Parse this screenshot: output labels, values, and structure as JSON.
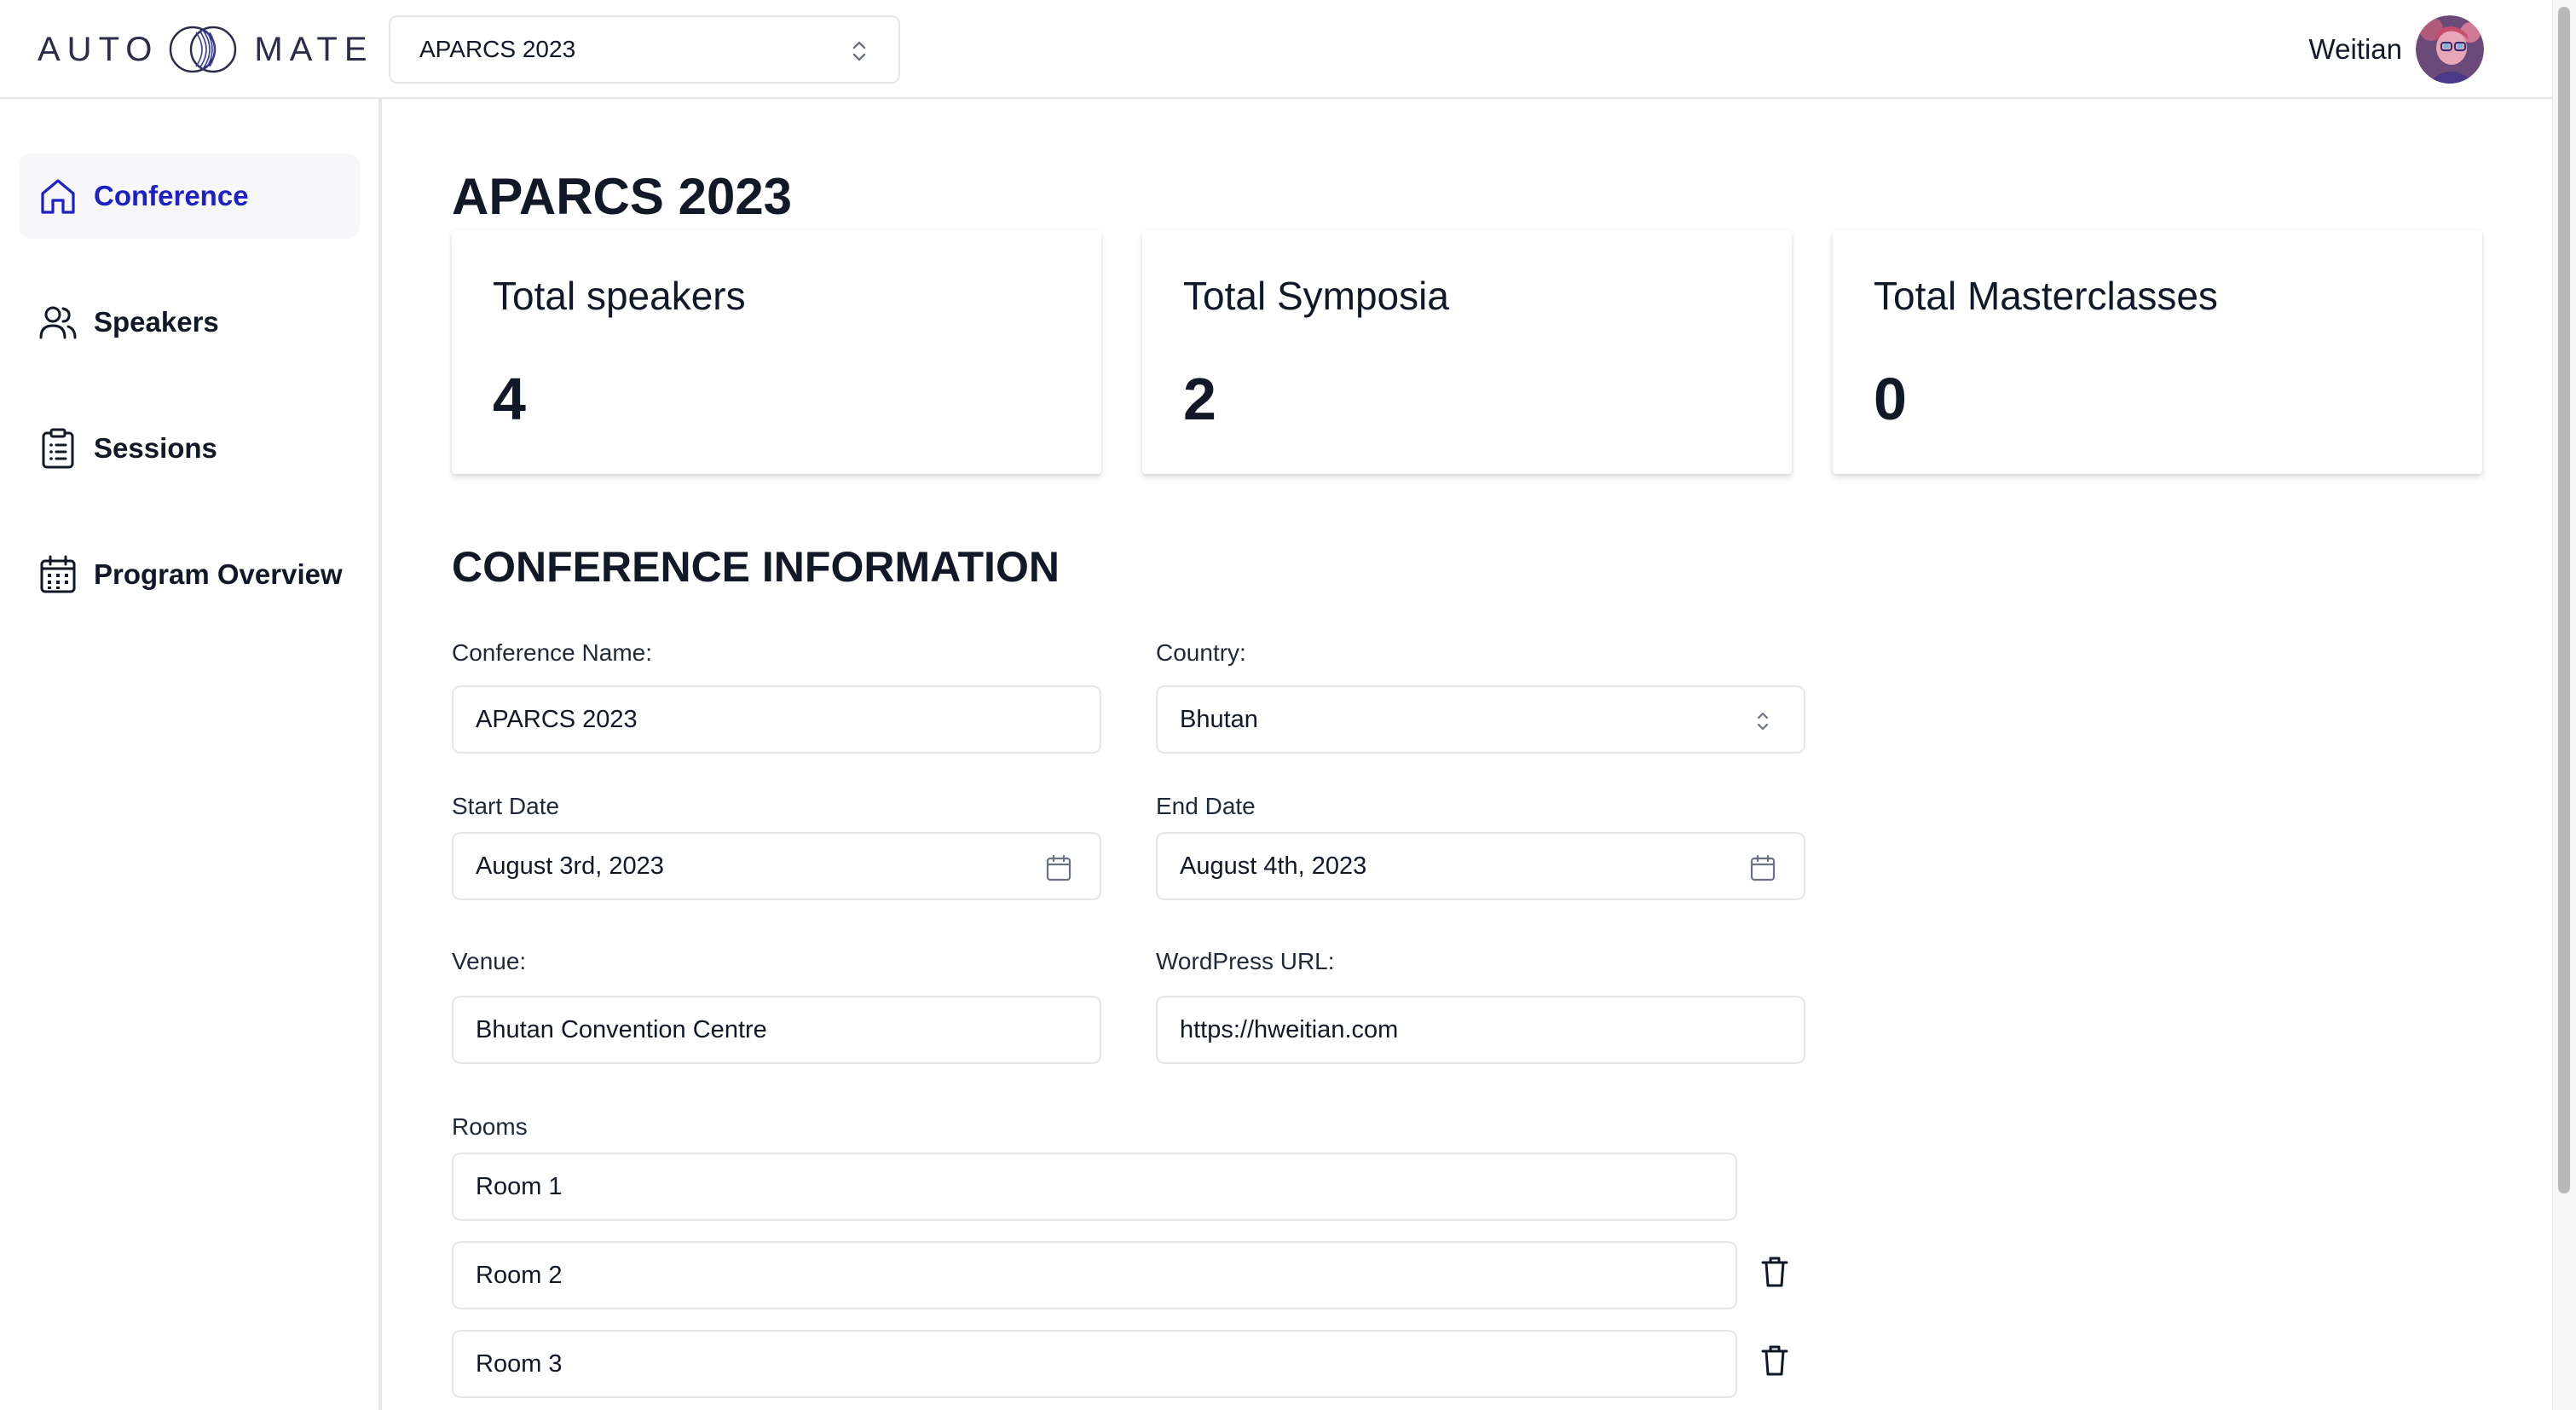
{
  "header": {
    "logo_left": "AUTO",
    "logo_right": "MATE",
    "conference_select_value": "APARCS 2023",
    "user_name": "Weitian"
  },
  "sidebar": {
    "items": [
      {
        "label": "Conference",
        "icon": "home-icon",
        "active": true
      },
      {
        "label": "Speakers",
        "icon": "users-icon",
        "active": false
      },
      {
        "label": "Sessions",
        "icon": "clipboard-list-icon",
        "active": false
      },
      {
        "label": "Program Overview",
        "icon": "calendar-icon",
        "active": false
      }
    ]
  },
  "main": {
    "title": "APARCS 2023",
    "stats": [
      {
        "label": "Total speakers",
        "value": "4"
      },
      {
        "label": "Total Symposia",
        "value": "2"
      },
      {
        "label": "Total Masterclasses",
        "value": "0"
      }
    ],
    "section_title": "CONFERENCE INFORMATION",
    "form": {
      "conference_name_label": "Conference Name:",
      "conference_name_value": "APARCS 2023",
      "country_label": "Country:",
      "country_value": "Bhutan",
      "start_date_label": "Start Date",
      "start_date_value": "August 3rd, 2023",
      "end_date_label": "End Date",
      "end_date_value": "August 4th, 2023",
      "venue_label": "Venue:",
      "venue_value": "Bhutan Convention Centre",
      "wordpress_label": "WordPress URL:",
      "wordpress_value": "https://hweitian.com",
      "rooms_label": "Rooms",
      "rooms": [
        "Room 1",
        "Room 2",
        "Room 3"
      ]
    }
  },
  "colors": {
    "accent": "#1d20c5",
    "text": "#111827",
    "border": "#e5e7eb",
    "active_bg": "#f7f7fa"
  }
}
